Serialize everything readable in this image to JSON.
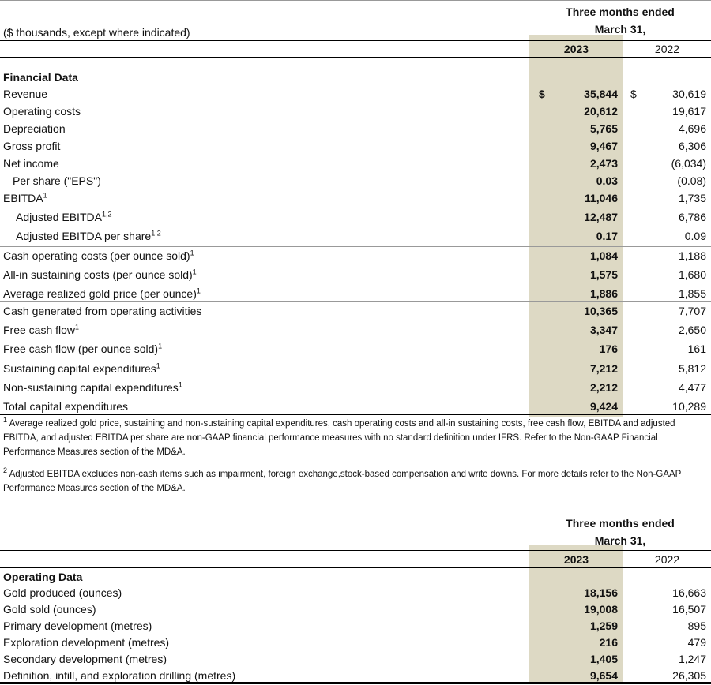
{
  "financial": {
    "units_label": "($ thousands, except where indicated)",
    "period_header_line1": "Three months ended",
    "period_header_line2": "March 31,",
    "year_current": "2023",
    "year_prior": "2022",
    "section_title": "Financial Data",
    "currency_symbol": "$",
    "rows": [
      {
        "label": "Revenue",
        "sup": "",
        "v2023": "35,844",
        "v2022": "30,619",
        "dollar": true
      },
      {
        "label": "Operating costs",
        "sup": "",
        "v2023": "20,612",
        "v2022": "19,617"
      },
      {
        "label": "Depreciation",
        "sup": "",
        "v2023": "5,765",
        "v2022": "4,696"
      },
      {
        "label": "Gross profit",
        "sup": "",
        "v2023": "9,467",
        "v2022": "6,306"
      },
      {
        "label": "Net income",
        "sup": "",
        "v2023": "2,473",
        "v2022": "(6,034)"
      },
      {
        "label": "Per share (\"EPS\")",
        "sup": "",
        "v2023": "0.03",
        "v2022": "(0.08)",
        "indent": 1
      },
      {
        "label": "EBITDA",
        "sup": "1",
        "v2023": "11,046",
        "v2022": "1,735"
      },
      {
        "label": "Adjusted EBITDA",
        "sup": "1,2",
        "v2023": "12,487",
        "v2022": "6,786",
        "indent": 2
      },
      {
        "label": "Adjusted EBITDA per share",
        "sup": "1,2",
        "v2023": "0.17",
        "v2022": "0.09",
        "indent": 2
      },
      {
        "label": "Cash operating costs (per ounce sold)",
        "sup": "1",
        "v2023": "1,084",
        "v2022": "1,188"
      },
      {
        "label": "All-in sustaining costs (per ounce sold)",
        "sup": "1",
        "v2023": "1,575",
        "v2022": "1,680"
      },
      {
        "label": "Average realized gold price (per ounce)",
        "sup": "1",
        "v2023": "1,886",
        "v2022": "1,855"
      },
      {
        "label": "Cash generated from operating activities",
        "sup": "",
        "v2023": "10,365",
        "v2022": "7,707"
      },
      {
        "label": "Free cash flow",
        "sup": "1",
        "v2023": "3,347",
        "v2022": "2,650"
      },
      {
        "label": "Free cash flow (per ounce sold)",
        "sup": "1",
        "v2023": "176",
        "v2022": "161"
      },
      {
        "label": "Sustaining capital expenditures",
        "sup": "1",
        "v2023": "7,212",
        "v2022": "5,812"
      },
      {
        "label": "Non-sustaining capital expenditures",
        "sup": "1",
        "v2023": "2,212",
        "v2022": "4,477"
      },
      {
        "label": "Total capital expenditures",
        "sup": "",
        "v2023": "9,424",
        "v2022": "10,289"
      }
    ],
    "footnote1_sup": "1",
    "footnote1": "Average realized gold price, sustaining and non-sustaining capital expenditures, cash operating costs and all-in sustaining costs, free cash flow, EBITDA and adjusted EBITDA, and adjusted EBITDA per share are non-GAAP financial performance measures with no standard definition under IFRS. Refer to the Non-GAAP Financial Performance Measures section of the MD&A.",
    "footnote2_sup": "2",
    "footnote2": "Adjusted EBITDA excludes non-cash items such as impairment, foreign exchange,stock-based compensation and write downs. For more details refer to the Non-GAAP Performance Measures section of the MD&A."
  },
  "operating": {
    "period_header_line1": "Three months ended",
    "period_header_line2": "March 31,",
    "year_current": "2023",
    "year_prior": "2022",
    "section_title": "Operating Data",
    "rows": [
      {
        "label": "Gold produced (ounces)",
        "v2023": "18,156",
        "v2022": "16,663"
      },
      {
        "label": "Gold sold (ounces)",
        "v2023": "19,008",
        "v2022": "16,507"
      },
      {
        "label": "Primary development (metres)",
        "v2023": "1,259",
        "v2022": "895"
      },
      {
        "label": "Exploration development (metres)",
        "v2023": "216",
        "v2022": "479"
      },
      {
        "label": "Secondary development (metres)",
        "v2023": "1,405",
        "v2022": "1,247"
      },
      {
        "label": "Definition, infill, and exploration drilling (metres)",
        "v2023": "9,654",
        "v2022": "26,305"
      }
    ]
  },
  "colors": {
    "highlight_column": "#ddd9c4",
    "rule": "#000000"
  }
}
